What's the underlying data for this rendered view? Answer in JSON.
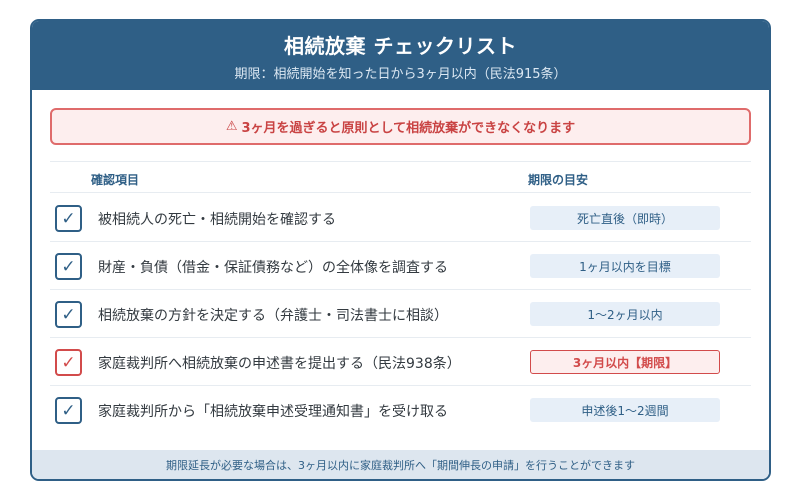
{
  "header": {
    "title": "相続放棄 チェックリスト",
    "subtitle": "期限：相続開始を知った日から3ヶ月以内（民法915条）"
  },
  "warning": {
    "icon": "warning-triangle-icon",
    "text": "3ヶ月を過ぎると原則として相続放棄ができなくなります"
  },
  "table": {
    "col_item": "確認項目",
    "col_deadline": "期限の目安",
    "rows": [
      {
        "checked": true,
        "check_glyph": "✓",
        "text": "被相続人の死亡・相続開始を確認する",
        "deadline": "死亡直後（即時）",
        "urgent": false
      },
      {
        "checked": true,
        "check_glyph": "✓",
        "text": "財産・負債（借金・保証債務など）の全体像を調査する",
        "deadline": "1ヶ月以内を目標",
        "urgent": false
      },
      {
        "checked": true,
        "check_glyph": "✓",
        "text": "相続放棄の方針を決定する（弁護士・司法書士に相談）",
        "deadline": "1〜2ヶ月以内",
        "urgent": false
      },
      {
        "checked": true,
        "check_glyph": "✓",
        "text": "家庭裁判所へ相続放棄の申述書を提出する（民法938条）",
        "deadline": "3ヶ月以内【期限】",
        "urgent": true
      },
      {
        "checked": true,
        "check_glyph": "✓",
        "text": "家庭裁判所から「相続放棄申述受理通知書」を受け取る",
        "deadline": "申述後1〜2週間",
        "urgent": false
      }
    ]
  },
  "footer": {
    "text": "期限延長が必要な場合は、3ヶ月以内に家庭裁判所へ「期間伸長の申請」を行うことができます"
  },
  "colors": {
    "primary": "#2f5f86",
    "alert": "#d24b4b",
    "badge_bg": "#e7eff8",
    "alert_bg": "#fdeeee"
  }
}
